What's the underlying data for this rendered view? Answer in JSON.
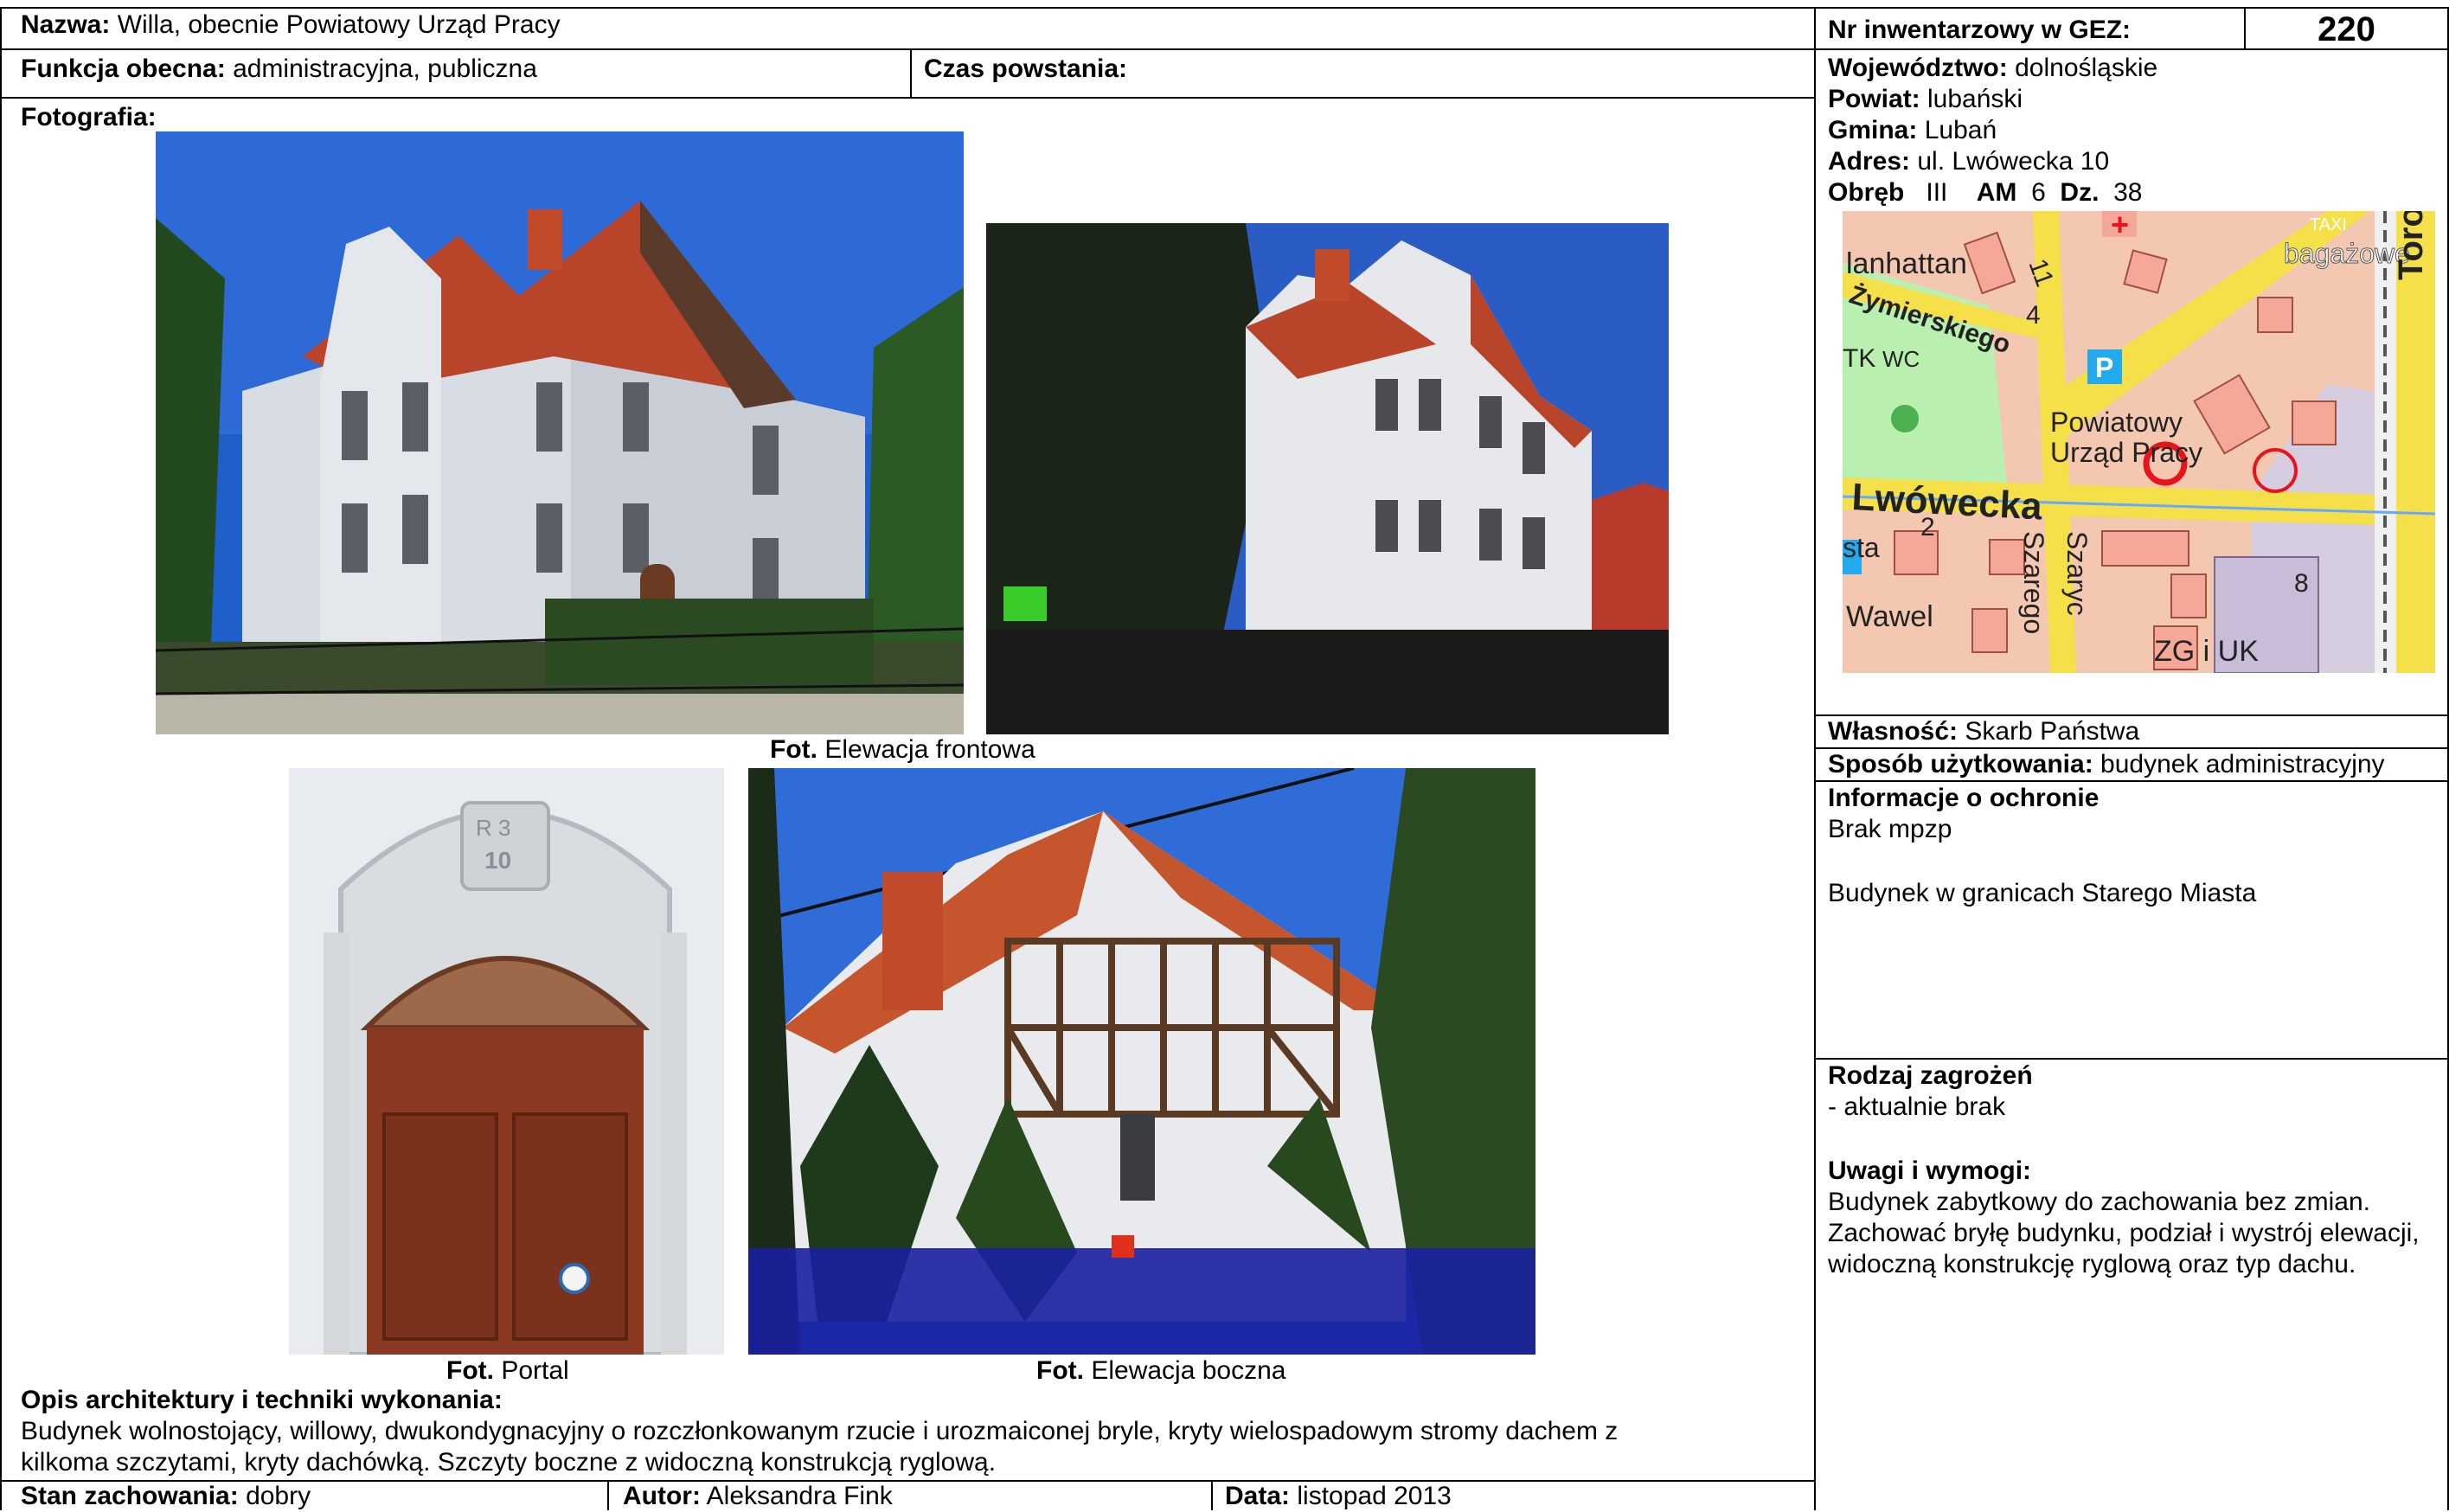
{
  "header": {
    "name_label": "Nazwa:",
    "name_value": "Willa, obecnie Powiatowy Urząd Pracy",
    "inv_label": "Nr inwentarzowy w GEZ:",
    "inv_value": "220"
  },
  "row2": {
    "function_label": "Funkcja obecna:",
    "function_value": "administracyjna, publiczna",
    "time_label": "Czas powstania:",
    "time_value": ""
  },
  "location": {
    "voivodeship_label": "Województwo:",
    "voivodeship_value": "dolnośląskie",
    "county_label": "Powiat:",
    "county_value": "lubański",
    "commune_label": "Gmina:",
    "commune_value": "Lubań",
    "address_label": "Adres:",
    "address_value": "ul. Lwówecka 10",
    "precinct_label": "Obręb",
    "precinct_value": "III",
    "am_label": "AM",
    "am_value": "6",
    "plot_label": "Dz.",
    "plot_value": "38"
  },
  "map": {
    "labels": [
      "lanhattan",
      "Żymierskiego",
      "Powiatowy",
      "Urząd Pracy",
      "Lwówecka",
      "Wawel",
      "ZG i UK",
      "bagażowe",
      "Torowa",
      "TK",
      "WC",
      "sta",
      "Szarego",
      "Szaryc",
      "2",
      "8",
      "11",
      "4",
      "TAXI"
    ],
    "marker_color": "#e8141c",
    "road_color": "#f5e04a",
    "park_color": "#b9f0b0",
    "background_color": "#f4c8b0"
  },
  "photos": {
    "section_label": "Fotografia:",
    "caption_front_label": "Fot.",
    "caption_front_text": "Elewacja frontowa",
    "caption_portal_label": "Fot.",
    "caption_portal_text": "Portal",
    "caption_side_label": "Fot.",
    "caption_side_text": "Elewacja boczna",
    "portal_number": "10"
  },
  "right": {
    "ownership_label": "Własność:",
    "ownership_value": "Skarb Państwa",
    "usage_label": "Sposób użytkowania:",
    "usage_value": "budynek administracyjny",
    "protection_title": "Informacje o ochronie",
    "protection_line1": "Brak mpzp",
    "protection_line2": "Budynek w granicach Starego Miasta",
    "threats_title": "Rodzaj zagrożeń",
    "threats_value": "- aktualnie brak",
    "remarks_title": "Uwagi i wymogi:",
    "remarks_value": "Budynek zabytkowy do zachowania bez zmian. Zachować bryłę budynku, podział i wystrój elewacji, widoczną konstrukcję ryglową oraz typ dachu."
  },
  "description": {
    "title": "Opis architektury i techniki wykonania:",
    "line1": "Budynek wolnostojący, willowy, dwukondygnacyjny o rozczłonkowanym rzucie i urozmaiconej bryle, kryty wielospadowym stromy dachem z",
    "line2": "kilkoma szczytami, kryty dachówką. Szczyty boczne z widoczną konstrukcją ryglową."
  },
  "footer": {
    "condition_label": "Stan zachowania:",
    "condition_value": "dobry",
    "author_label": "Autor:",
    "author_value": "Aleksandra Fink",
    "date_label": "Data:",
    "date_value": "listopad 2013"
  }
}
